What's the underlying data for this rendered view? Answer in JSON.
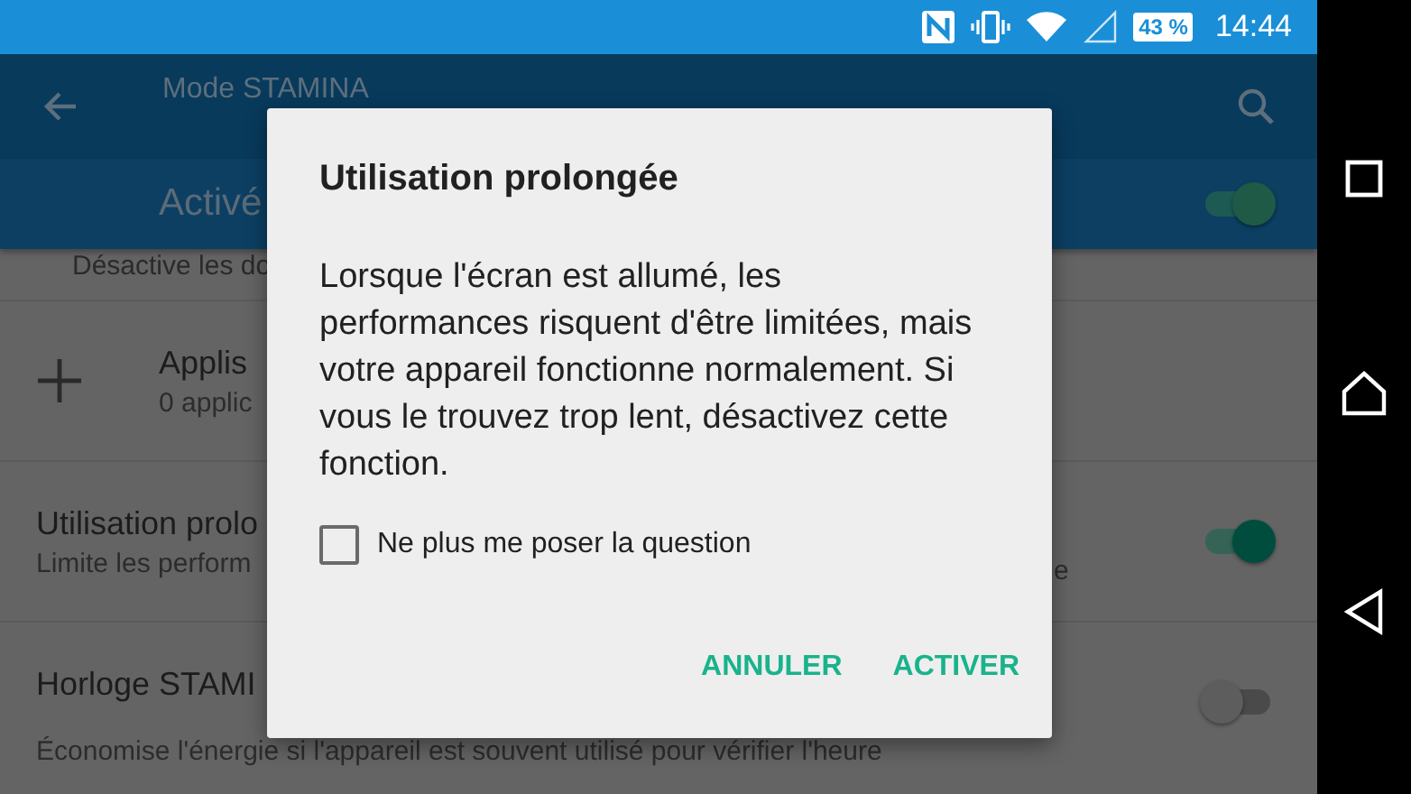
{
  "status_bar": {
    "battery": "43 %",
    "time": "14:44"
  },
  "app_bar": {
    "title": "Mode STAMINA"
  },
  "master": {
    "label": "Activé",
    "on": true,
    "subtitle": "Désactive les do"
  },
  "rows": [
    {
      "kind": "add",
      "title": "Applis",
      "subtitle": "0 applic"
    },
    {
      "kind": "switch",
      "title": "Utilisation prolo",
      "subtitle": "Limite les perform",
      "subtitle_end": "e",
      "on": true
    },
    {
      "kind": "switch",
      "title": "Horloge STAMI",
      "subtitle": "Économise l'énergie si l'appareil est souvent utilisé pour vérifier l'heure",
      "on": false
    }
  ],
  "dialog": {
    "title": "Utilisation prolongée",
    "message": "Lorsque l'écran est allumé, les performances risquent d'être limitées, mais votre appareil fonctionne normalement. Si vous le trouvez trop lent, désactivez cette fonction.",
    "checkbox": {
      "label": "Ne plus me poser la question",
      "checked": false
    },
    "buttons": [
      "ANNULER",
      "ACTIVER"
    ]
  }
}
